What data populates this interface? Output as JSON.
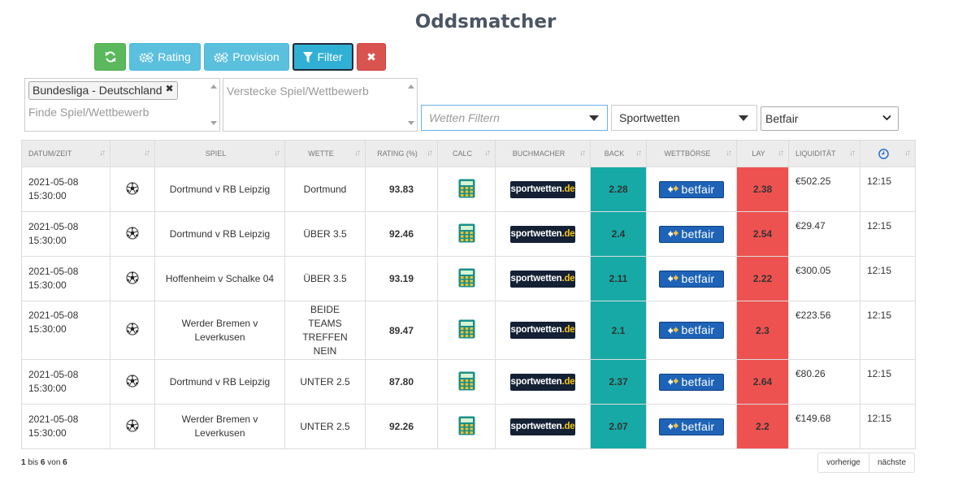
{
  "title": "Oddsmatcher",
  "toolbar": {
    "rating_label": "Rating",
    "provision_label": "Provision",
    "filter_label": "Filter",
    "close_label": "✖"
  },
  "filters": {
    "competition_tag": "Bundesliga - Deutschland",
    "competition_placeholder": "Finde Spiel/Wettbewerb",
    "hide_placeholder": "Verstecke Spiel/Wettbewerb",
    "bet_filter_placeholder": "Wetten Filtern",
    "sport_selected": "Sportwetten",
    "exchange_selected": "Betfair"
  },
  "columns": {
    "date": "Datum/Zeit",
    "game": "Spiel",
    "bet": "Wette",
    "rating": "Rating (%)",
    "calc": "Calc",
    "bookmaker": "Buchmacher",
    "back": "Back",
    "exchange": "Wettbörse",
    "lay": "Lay",
    "liquidity": "Liquidität"
  },
  "logos": {
    "bookmaker_a": "sportwetten",
    "bookmaker_b": ".de",
    "exchange": "betfair"
  },
  "rows": [
    {
      "date": "2021-05-08",
      "time": "15:30:00",
      "game": "Dortmund v RB Leipzig",
      "bet": "Dortmund",
      "rating": "93.83",
      "back": "2.28",
      "lay": "2.38",
      "liquidity": "€502.25",
      "clock": "12:15"
    },
    {
      "date": "2021-05-08",
      "time": "15:30:00",
      "game": "Dortmund v RB Leipzig",
      "bet": "ÜBER 3.5",
      "rating": "92.46",
      "back": "2.4",
      "lay": "2.54",
      "liquidity": "€29.47",
      "clock": "12:15"
    },
    {
      "date": "2021-05-08",
      "time": "15:30:00",
      "game": "Hoffenheim v Schalke 04",
      "bet": "ÜBER 3.5",
      "rating": "93.19",
      "back": "2.11",
      "lay": "2.22",
      "liquidity": "€300.05",
      "clock": "12:15"
    },
    {
      "date": "2021-05-08",
      "time": "15:30:00",
      "game": "Werder Bremen v Leverkusen",
      "bet": "BEIDE TEAMS TREFFEN NEIN",
      "rating": "89.47",
      "back": "2.1",
      "lay": "2.3",
      "liquidity": "€223.56",
      "clock": "12:15"
    },
    {
      "date": "2021-05-08",
      "time": "15:30:00",
      "game": "Dortmund v RB Leipzig",
      "bet": "UNTER 2.5",
      "rating": "87.80",
      "back": "2.37",
      "lay": "2.64",
      "liquidity": "€80.26",
      "clock": "12:15"
    },
    {
      "date": "2021-05-08",
      "time": "15:30:00",
      "game": "Werder Bremen v Leverkusen",
      "bet": "UNTER 2.5",
      "rating": "92.26",
      "back": "2.07",
      "lay": "2.2",
      "liquidity": "€149.68",
      "clock": "12:15"
    }
  ],
  "pagination": {
    "from": "1",
    "to": "6",
    "total": "6",
    "bis": "bis",
    "von": "von",
    "prev_label": "vorherige",
    "next_label": "nächste"
  },
  "colors": {
    "back": "#17a9a5",
    "lay": "#ee5250",
    "refresh": "#5cb85c",
    "info": "#5bc0de",
    "danger": "#d9534f"
  }
}
